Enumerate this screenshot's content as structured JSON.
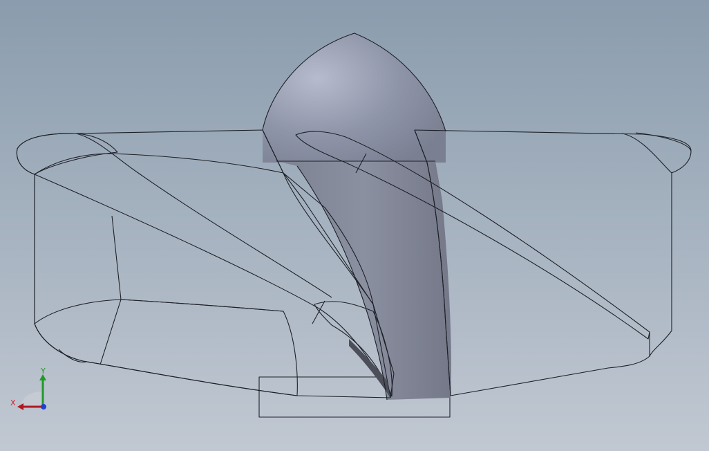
{
  "viewport": {
    "background_top": "#8a9cad",
    "background_bottom": "#c1c8d2"
  },
  "model": {
    "light_face_color": "#8d93a6",
    "dark_face_color": "#50525c",
    "edge_color": "#1d2027"
  },
  "triad": {
    "x_label": "X",
    "y_label": "Y",
    "x_color": "#d8202a",
    "y_color": "#1f9a2a",
    "z_color": "#1f3fd0"
  }
}
